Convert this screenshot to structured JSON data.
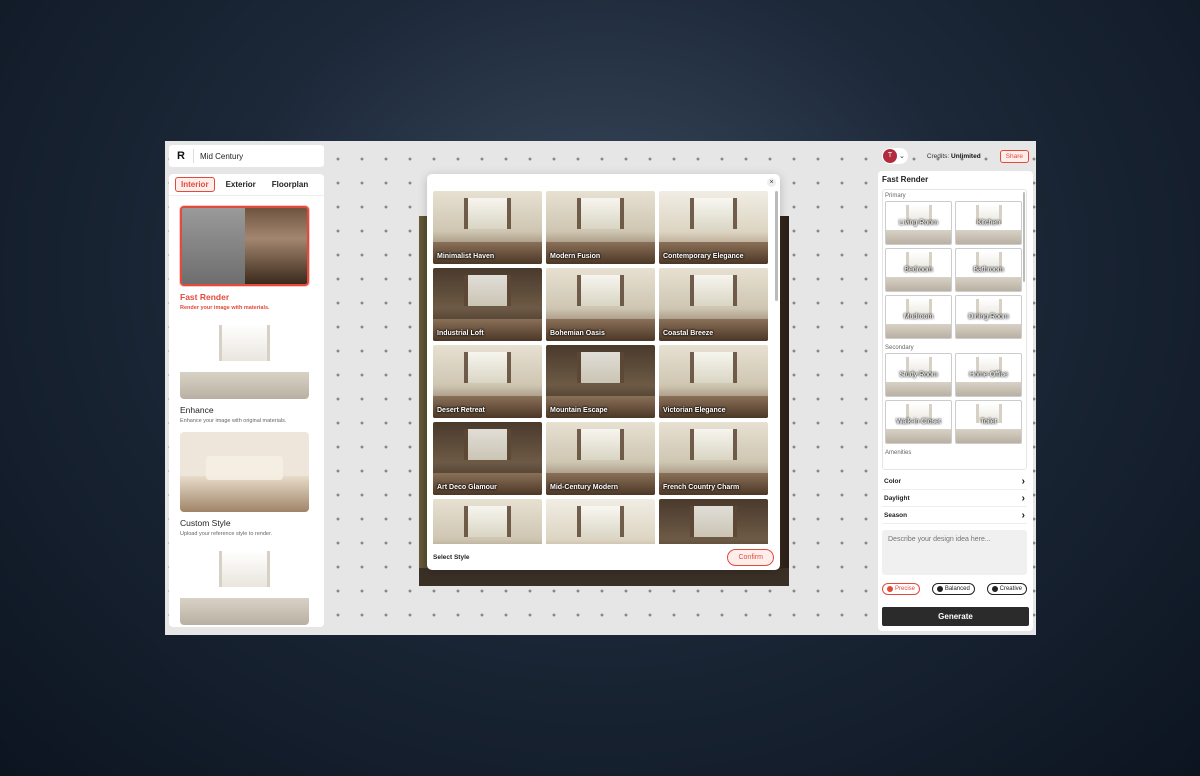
{
  "project": {
    "logo": "R",
    "name": "Mid Century"
  },
  "left_tabs": [
    "Interior",
    "Exterior",
    "Floorplan"
  ],
  "modes": [
    {
      "title": "Fast Render",
      "desc": "Render your image with materials."
    },
    {
      "title": "Enhance",
      "desc": "Enhance your image with original materials."
    },
    {
      "title": "Custom Style",
      "desc": "Upload your reference style to render."
    }
  ],
  "modal": {
    "close": "×",
    "styles": [
      "Minimalist Haven",
      "Modern Fusion",
      "Contemporary Elegance",
      "Industrial Loft",
      "Bohemian Oasis",
      "Coastal Breeze",
      "Desert Retreat",
      "Mountain Escape",
      "Victorian Elegance",
      "Art Deco Glamour",
      "Mid-Century Modern",
      "French Country Charm",
      "",
      "",
      ""
    ],
    "footer_label": "Select Style",
    "confirm": "Confirm"
  },
  "header": {
    "avatar": "T",
    "chevron": "⌄",
    "credits_label": "Credits:",
    "credits_value": "Unlimited",
    "share": "Share"
  },
  "right": {
    "title": "Fast Render",
    "primary_label": "Primary",
    "primary": [
      "Living Room",
      "Kitchen",
      "Bedroom",
      "Bathroom",
      "Mudroom",
      "Dining Room"
    ],
    "secondary_label": "Secondary",
    "secondary": [
      "Study Room",
      "Home Office",
      "Walk-in Closet",
      "Toilet"
    ],
    "amenities_label": "Amenities",
    "rows": [
      "Color",
      "Daylight",
      "Season"
    ],
    "arrow": "›",
    "prompt_placeholder": "Describe your design idea here...",
    "creativity": [
      "Precise",
      "Balanced",
      "Creative"
    ],
    "generate": "Generate"
  },
  "colors": {
    "accent": "#e24a3c",
    "dark": "#2b2b2b"
  }
}
